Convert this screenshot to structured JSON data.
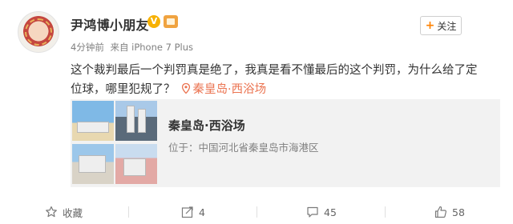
{
  "user": {
    "name": "尹鸿博小朋友",
    "verified_mark": "V"
  },
  "post_meta": {
    "time_text": "4分钟前",
    "source_text": "来自 iPhone 7 Plus"
  },
  "follow_button": {
    "plus": "+",
    "label": "关注"
  },
  "post_text": {
    "line1": "这个裁判最后一个判罚真是绝了，我真是看不懂最后的这个判罚，为什么给了定",
    "line2": "位球，哪里犯规了？",
    "location_link": "秦皇岛·西浴场"
  },
  "location_card": {
    "title": "秦皇岛·西浴场",
    "address": "位于：中国河北省秦皇岛市海港区"
  },
  "actions": {
    "favorite_label": "收藏",
    "share_count": "4",
    "comment_count": "45",
    "like_count": "58"
  },
  "icons": {
    "avatar": "avatar-image",
    "verified": "verified-icon",
    "vip": "vip-badge-icon",
    "pin": "location-pin-icon",
    "favorite": "star-icon",
    "share": "share-icon",
    "comment": "comment-icon",
    "like": "thumbs-up-icon"
  },
  "colors": {
    "accent_orange": "#ff8200",
    "link": "#eb7350",
    "card_bg": "#f2f2f2",
    "muted_text": "#808080"
  }
}
